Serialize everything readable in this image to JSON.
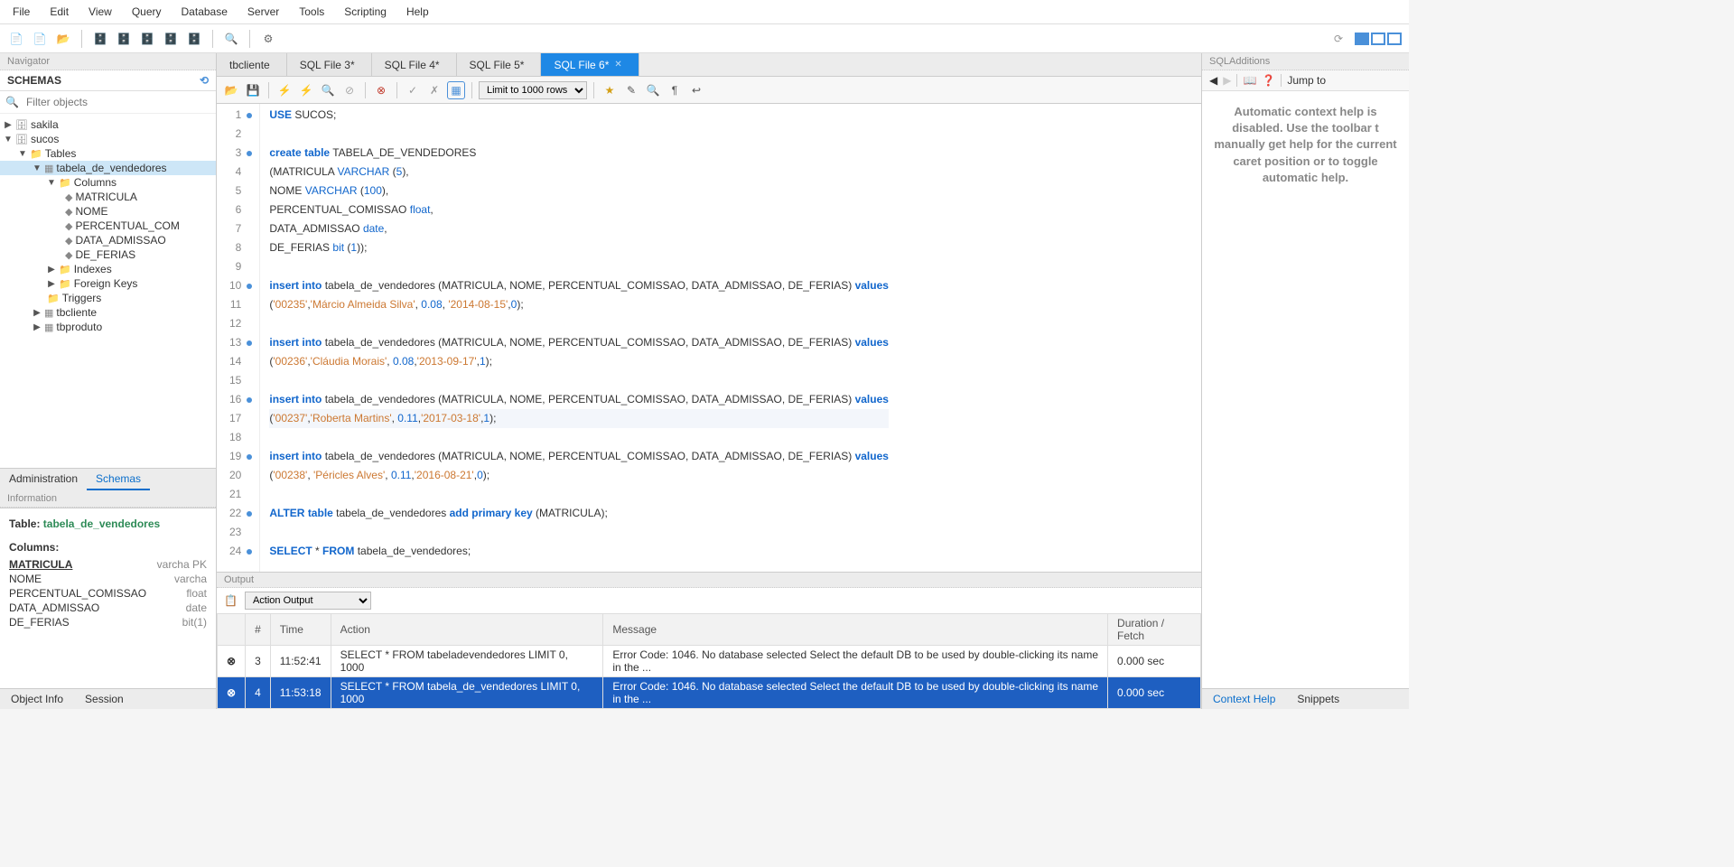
{
  "menu": [
    "File",
    "Edit",
    "View",
    "Query",
    "Database",
    "Server",
    "Tools",
    "Scripting",
    "Help"
  ],
  "navigator": {
    "title": "Navigator",
    "schemas_label": "SCHEMAS",
    "filter_placeholder": "Filter objects",
    "tree": {
      "sakila": "sakila",
      "sucos": "sucos",
      "tables": "Tables",
      "tabela_de_vendedores": "tabela_de_vendedores",
      "columns": "Columns",
      "cols": [
        "MATRICULA",
        "NOME",
        "PERCENTUAL_COM",
        "DATA_ADMISSAO",
        "DE_FERIAS"
      ],
      "indexes": "Indexes",
      "foreign_keys": "Foreign Keys",
      "triggers": "Triggers",
      "tbcliente": "tbcliente",
      "tbproduto": "tbproduto"
    },
    "tabs": {
      "administration": "Administration",
      "schemas": "Schemas"
    }
  },
  "information": {
    "title": "Information",
    "table_label": "Table:",
    "table_name": "tabela_de_vendedores",
    "columns_label": "Columns:",
    "rows": [
      {
        "name": "MATRICULA",
        "type": "varcha PK"
      },
      {
        "name": "NOME",
        "type": "varcha"
      },
      {
        "name": "PERCENTUAL_COMISSAO",
        "type": "float"
      },
      {
        "name": "DATA_ADMISSAO",
        "type": "date"
      },
      {
        "name": "DE_FERIAS",
        "type": "bit(1)"
      }
    ],
    "tabs": {
      "object_info": "Object Info",
      "session": "Session"
    }
  },
  "editor_tabs": [
    "tbcliente",
    "SQL File 3*",
    "SQL File 4*",
    "SQL File 5*",
    "SQL File 6*"
  ],
  "active_tab_index": 4,
  "sql_toolbar": {
    "limit": "Limit to 1000 rows"
  },
  "sql_lines": [
    {
      "n": 1,
      "dot": true,
      "html": "<span class='kw'>USE</span> SUCOS;"
    },
    {
      "n": 2,
      "dot": false,
      "html": ""
    },
    {
      "n": 3,
      "dot": true,
      "html": "<span class='kw'>create</span> <span class='kw'>table</span> TABELA_DE_VENDEDORES"
    },
    {
      "n": 4,
      "dot": false,
      "html": "(MATRICULA <span class='ty'>VARCHAR</span> (<span class='num'>5</span>),"
    },
    {
      "n": 5,
      "dot": false,
      "html": "NOME <span class='ty'>VARCHAR</span> (<span class='num'>100</span>),"
    },
    {
      "n": 6,
      "dot": false,
      "html": "PERCENTUAL_COMISSAO <span class='ty'>float</span>,"
    },
    {
      "n": 7,
      "dot": false,
      "html": "DATA_ADMISSAO <span class='ty'>date</span>,"
    },
    {
      "n": 8,
      "dot": false,
      "html": "DE_FERIAS <span class='ty'>bit</span> (<span class='num'>1</span>));"
    },
    {
      "n": 9,
      "dot": false,
      "html": ""
    },
    {
      "n": 10,
      "dot": true,
      "html": "<span class='kw'>insert</span> <span class='kw'>into</span> tabela_de_vendedores (MATRICULA, NOME, PERCENTUAL_COMISSAO, DATA_ADMISSAO, DE_FERIAS) <span class='kw'>values</span>"
    },
    {
      "n": 11,
      "dot": false,
      "html": "(<span class='str'>'00235'</span>,<span class='str'>'Márcio Almeida Silva'</span>, <span class='num'>0.08</span>, <span class='str'>'2014-08-15'</span>,<span class='num'>0</span>);"
    },
    {
      "n": 12,
      "dot": false,
      "html": ""
    },
    {
      "n": 13,
      "dot": true,
      "html": "<span class='kw'>insert</span> <span class='kw'>into</span> tabela_de_vendedores (MATRICULA, NOME, PERCENTUAL_COMISSAO, DATA_ADMISSAO, DE_FERIAS) <span class='kw'>values</span>"
    },
    {
      "n": 14,
      "dot": false,
      "html": "(<span class='str'>'00236'</span>,<span class='str'>'Cláudia Morais'</span>, <span class='num'>0.08</span>,<span class='str'>'2013-09-17'</span>,<span class='num'>1</span>);"
    },
    {
      "n": 15,
      "dot": false,
      "html": ""
    },
    {
      "n": 16,
      "dot": true,
      "html": "<span class='kw'>insert</span> <span class='kw'>into</span> tabela_de_vendedores (MATRICULA, NOME, PERCENTUAL_COMISSAO, DATA_ADMISSAO, DE_FERIAS) <span class='kw'>values</span>"
    },
    {
      "n": 17,
      "dot": false,
      "html": "(<span class='str'>'00237'</span>,<span class='str'>'Roberta Martins'</span>, <span class='num'>0.11</span>,<span class='str'>'2017-03-18'</span>,<span class='num'>1</span>);",
      "cursor": true
    },
    {
      "n": 18,
      "dot": false,
      "html": ""
    },
    {
      "n": 19,
      "dot": true,
      "html": "<span class='kw'>insert</span> <span class='kw'>into</span> tabela_de_vendedores (MATRICULA, NOME, PERCENTUAL_COMISSAO, DATA_ADMISSAO, DE_FERIAS) <span class='kw'>values</span>"
    },
    {
      "n": 20,
      "dot": false,
      "html": "(<span class='str'>'00238'</span>, <span class='str'>'Péricles Alves'</span>, <span class='num'>0.11</span>,<span class='str'>'2016-08-21'</span>,<span class='num'>0</span>);"
    },
    {
      "n": 21,
      "dot": false,
      "html": ""
    },
    {
      "n": 22,
      "dot": true,
      "html": "<span class='kw'>ALTER</span> <span class='kw'>table</span> tabela_de_vendedores <span class='kw'>add</span> <span class='kw'>primary</span> <span class='kw'>key</span> (MATRICULA);"
    },
    {
      "n": 23,
      "dot": false,
      "html": ""
    },
    {
      "n": 24,
      "dot": true,
      "html": "<span class='kw'>SELECT</span> * <span class='kw'>FROM</span> tabela_de_vendedores;"
    }
  ],
  "output": {
    "title": "Output",
    "dropdown": "Action Output",
    "headers": [
      "",
      "#",
      "Time",
      "Action",
      "Message",
      "Duration / Fetch"
    ],
    "rows": [
      {
        "sel": false,
        "n": "3",
        "time": "11:52:41",
        "action": "SELECT * FROM tabeladevendedores LIMIT 0, 1000",
        "msg": "Error Code: 1046. No database selected Select the default DB to be used by double-clicking its name in the ...",
        "dur": "0.000 sec"
      },
      {
        "sel": true,
        "n": "4",
        "time": "11:53:18",
        "action": "SELECT * FROM tabela_de_vendedores LIMIT 0, 1000",
        "msg": "Error Code: 1046. No database selected Select the default DB to be used by double-clicking its name in the ...",
        "dur": "0.000 sec"
      }
    ]
  },
  "additions": {
    "title": "SQLAdditions",
    "jump_to": "Jump to",
    "body": "Automatic context help is disabled. Use the toolbar t manually get help for the current caret position or to toggle automatic help.",
    "tabs": {
      "context_help": "Context Help",
      "snippets": "Snippets"
    }
  }
}
